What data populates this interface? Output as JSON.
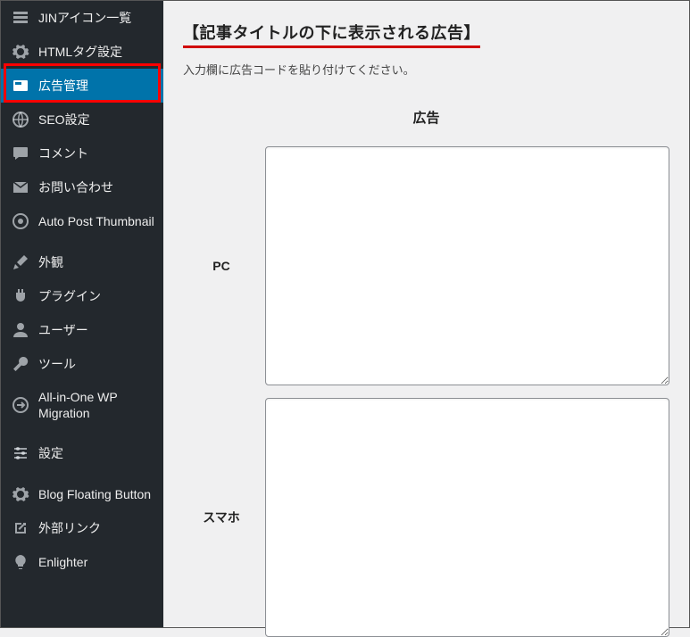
{
  "sidebar": {
    "items": [
      {
        "label": "JINアイコン一覧",
        "icon": "list-icon"
      },
      {
        "label": "HTMLタグ設定",
        "icon": "cog-icon"
      },
      {
        "label": "広告管理",
        "icon": "ad-icon",
        "active": true
      },
      {
        "label": "SEO設定",
        "icon": "globe-icon"
      },
      {
        "label": "コメント",
        "icon": "comment-icon"
      },
      {
        "label": "お問い合わせ",
        "icon": "mail-icon"
      },
      {
        "label": "Auto Post Thumbnail",
        "icon": "target-icon"
      },
      {
        "label": "外観",
        "icon": "brush-icon"
      },
      {
        "label": "プラグイン",
        "icon": "plug-icon"
      },
      {
        "label": "ユーザー",
        "icon": "user-icon"
      },
      {
        "label": "ツール",
        "icon": "wrench-icon"
      },
      {
        "label": "All-in-One WP Migration",
        "icon": "migrate-icon"
      },
      {
        "label": "設定",
        "icon": "sliders-icon"
      },
      {
        "label": "Blog Floating Button",
        "icon": "gear-icon"
      },
      {
        "label": "外部リンク",
        "icon": "external-icon"
      },
      {
        "label": "Enlighter",
        "icon": "bulb-icon"
      }
    ]
  },
  "content": {
    "section_title": "【記事タイトルの下に表示される広告】",
    "section_desc": "入力欄に広告コードを貼り付けてください。",
    "ad_heading": "広告",
    "pc_label": "PC",
    "sp_label": "スマホ",
    "pc_value": "",
    "sp_value": ""
  }
}
